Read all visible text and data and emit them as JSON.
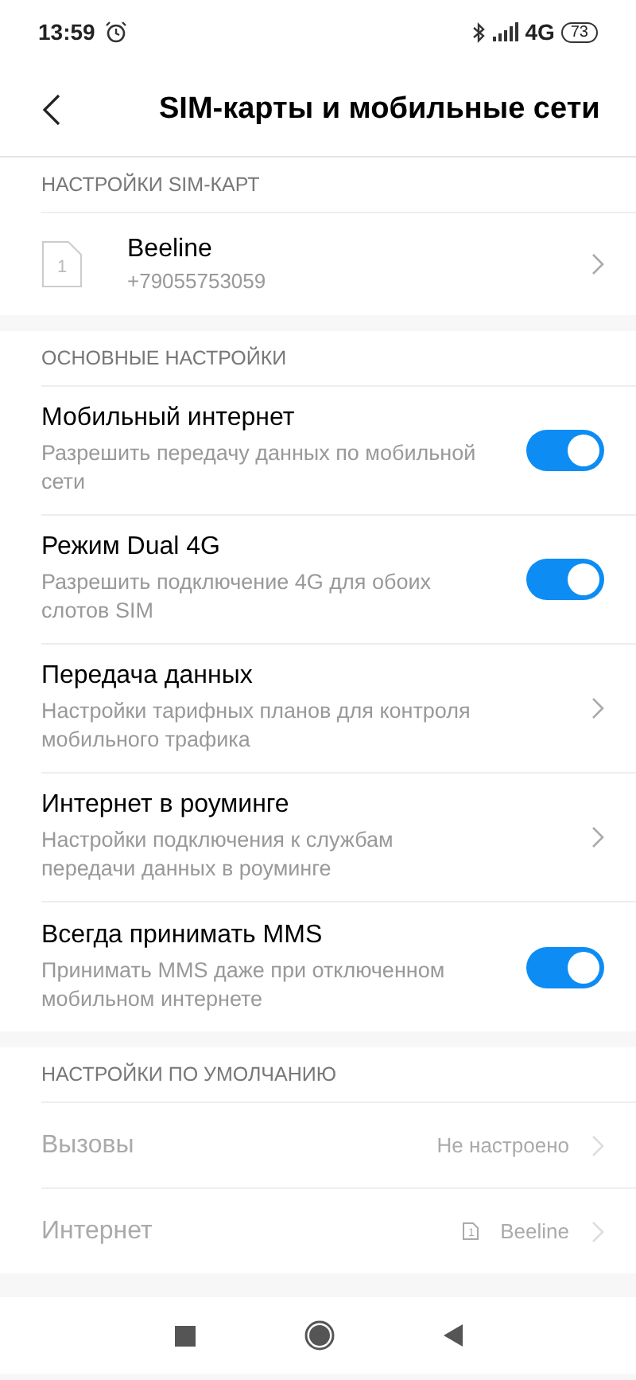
{
  "status_bar": {
    "time": "13:59",
    "network": "4G",
    "battery": "73"
  },
  "header": {
    "title": "SIM-карты и мобильные сети"
  },
  "sim_section": {
    "title": "НАСТРОЙКИ SIM-КАРТ",
    "sims": [
      {
        "slot": "1",
        "name": "Beeline",
        "number": "+79055753059"
      }
    ]
  },
  "main_section": {
    "title": "ОСНОВНЫЕ НАСТРОЙКИ",
    "items": [
      {
        "kind": "toggle",
        "title": "Мобильный интернет",
        "subtitle": "Разрешить передачу данных по мобильной сети",
        "on": true
      },
      {
        "kind": "toggle",
        "title": "Режим Dual 4G",
        "subtitle": "Разрешить подключение 4G для обоих слотов SIM",
        "on": true
      },
      {
        "kind": "link",
        "title": "Передача данных",
        "subtitle": "Настройки тарифных планов для контроля мобильного трафика"
      },
      {
        "kind": "link",
        "title": "Интернет в роуминге",
        "subtitle": "Настройки подключения к службам передачи данных в роуминге"
      },
      {
        "kind": "toggle",
        "title": "Всегда принимать MMS",
        "subtitle": "Принимать MMS даже при отключенном мобильном интернете",
        "on": true
      }
    ]
  },
  "default_section": {
    "title": "НАСТРОЙКИ ПО УМОЛЧАНИЮ",
    "items": [
      {
        "title": "Вызовы",
        "value": "Не настроено",
        "disabled": true
      },
      {
        "title": "Интернет",
        "value": "Beeline",
        "sim_slot": "1",
        "disabled": true
      }
    ]
  }
}
